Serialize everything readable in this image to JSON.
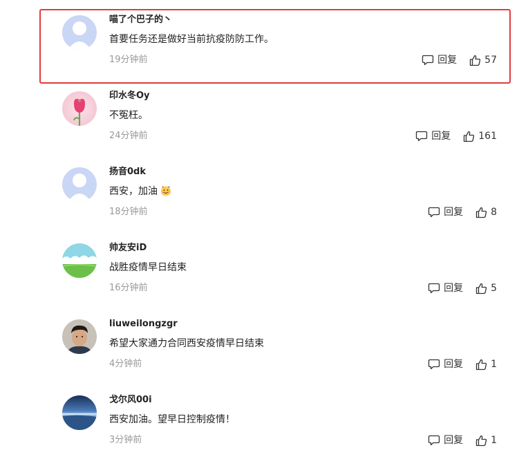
{
  "comments": [
    {
      "username": "喵了个巴子的丶",
      "content": "首要任务还是做好当前抗疫防防工作。",
      "time": "19分钟前",
      "reply_label": "回复",
      "likes": "57",
      "avatar": "default-avatar-icon"
    },
    {
      "username": "印水冬Oy",
      "content": "不冤枉。",
      "time": "24分钟前",
      "reply_label": "回复",
      "likes": "161",
      "avatar": "tulip-avatar"
    },
    {
      "username": "扬音0dk",
      "content": "西安，加油",
      "time": "18分钟前",
      "reply_label": "回复",
      "likes": "8",
      "avatar": "default-avatar-icon",
      "emoji": "cheer-emoji"
    },
    {
      "username": "帅友安iD",
      "content": "战胜疫情早日结束",
      "time": "16分钟前",
      "reply_label": "回复",
      "likes": "5",
      "avatar": "landscape-avatar"
    },
    {
      "username": "liuweilongzgr",
      "content": "希望大家通力合同西安疫情早日结束",
      "time": "4分钟前",
      "reply_label": "回复",
      "likes": "1",
      "avatar": "person-photo-avatar"
    },
    {
      "username": "戈尔风00i",
      "content": "西安加油。望早日控制疫情！",
      "time": "3分钟前",
      "reply_label": "回复",
      "likes": "1",
      "avatar": "seascape-avatar"
    }
  ],
  "colors": {
    "highlight_border": "#e23a3a",
    "username": "#222222",
    "content": "#222222",
    "time": "#999999",
    "default_avatar_bg": "#c9d6f5"
  }
}
